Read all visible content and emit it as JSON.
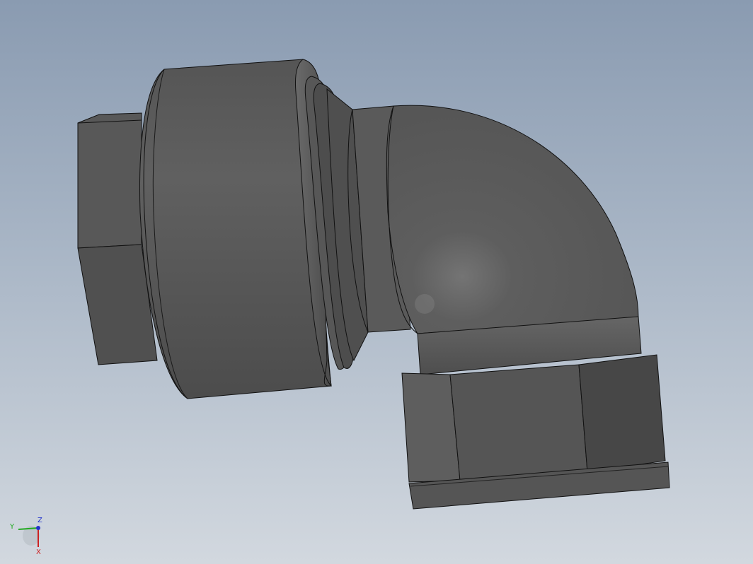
{
  "viewport": {
    "background_top": "#8a9bb1",
    "background_bottom": "#d2d8df",
    "model_color": "#5c5c5c",
    "edge_color": "#111111"
  },
  "triad": {
    "x_label": "X",
    "y_label": "Y",
    "z_label": "Z",
    "x_color": "#cc2222",
    "y_color": "#22aa22",
    "z_color": "#2233cc"
  }
}
